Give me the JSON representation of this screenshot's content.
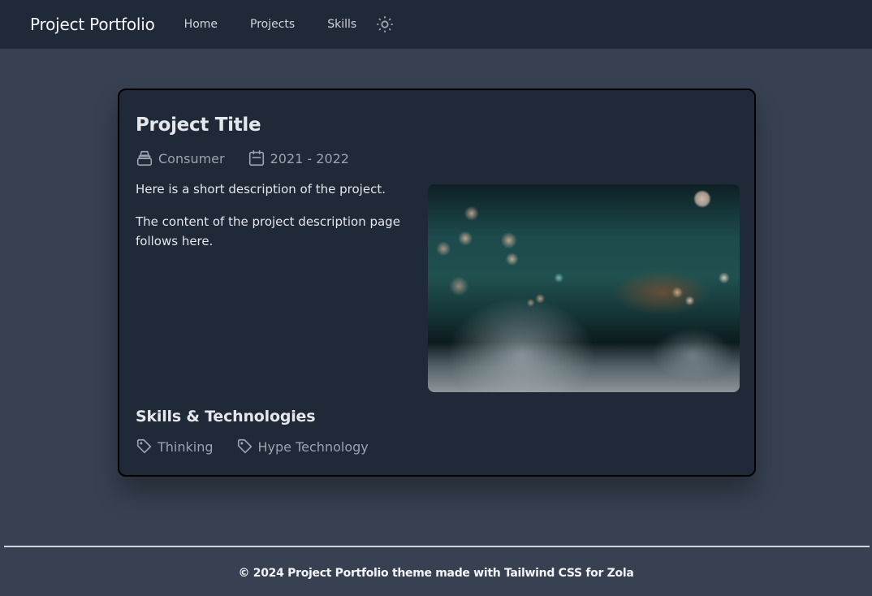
{
  "navbar": {
    "brand": "Project Portfolio",
    "links": [
      {
        "label": "Home"
      },
      {
        "label": "Projects"
      },
      {
        "label": "Skills"
      }
    ],
    "theme_toggle_icon": "sun-icon"
  },
  "project": {
    "title": "Project Title",
    "category": {
      "icon": "inbox-tray-icon",
      "label": "Consumer"
    },
    "period": {
      "icon": "calendar-icon",
      "label": "2021 - 2022"
    },
    "description": [
      "Here is a short description of the project.",
      "The content of the project description page follows here."
    ],
    "image_alt": "Close-up of water splashing over dark rocks with bokeh highlights",
    "skills_heading": "Skills & Technologies",
    "tags": [
      {
        "icon": "tag-icon",
        "label": "Thinking"
      },
      {
        "icon": "tag-icon",
        "label": "Hype Technology"
      }
    ]
  },
  "footer": {
    "text": "© 2024 Project Portfolio theme made with Tailwind CSS for Zola"
  },
  "colors": {
    "page_bg": "#374151",
    "surface": "#1f2937",
    "text": "#e5e7eb",
    "muted": "#9ca3af"
  }
}
